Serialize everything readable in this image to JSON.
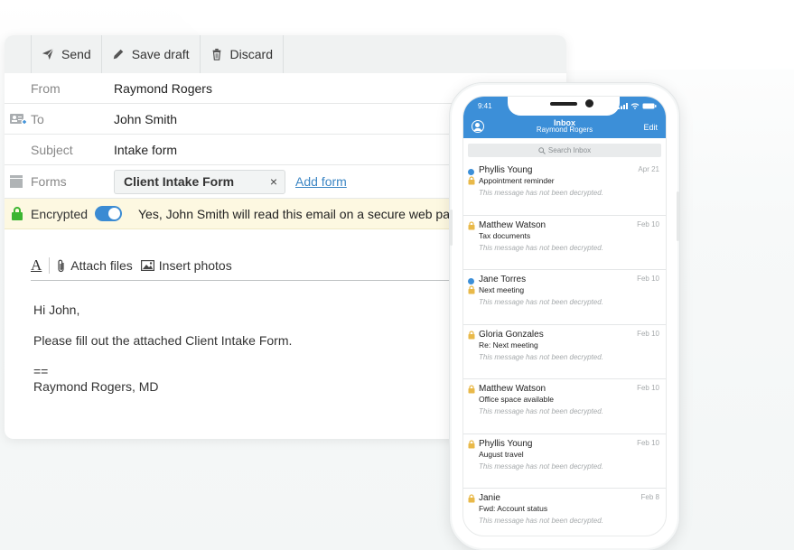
{
  "toolbar": {
    "send": "Send",
    "save_draft": "Save draft",
    "discard": "Discard"
  },
  "fields": {
    "from_label": "From",
    "from_value": "Raymond Rogers",
    "to_label": "To",
    "to_value": "John Smith",
    "subject_label": "Subject",
    "subject_value": "Intake form",
    "forms_label": "Forms",
    "form_chip": "Client Intake Form",
    "form_chip_remove": "×",
    "add_form": "Add form"
  },
  "encryption": {
    "label": "Encrypted",
    "enabled": true,
    "message": "Yes, John Smith will read this email on a secure web pa"
  },
  "format_bar": {
    "text_format": "A",
    "attach_files": "Attach files",
    "insert_photos": "Insert photos"
  },
  "body": {
    "greeting": "Hi John,",
    "line1": "Please fill out the attached Client Intake Form.",
    "separator": "==",
    "signature": "Raymond Rogers, MD"
  },
  "phone": {
    "time": "9:41",
    "title": "Inbox",
    "subtitle": "Raymond Rogers",
    "edit": "Edit",
    "search_placeholder": "Search Inbox",
    "messages": [
      {
        "sender": "Phyllis Young",
        "subject": "Appointment reminder",
        "preview": "This message has not been decrypted.",
        "date": "Apr 21",
        "unread": true
      },
      {
        "sender": "Matthew Watson",
        "subject": "Tax documents",
        "preview": "This message has not been decrypted.",
        "date": "Feb 10",
        "unread": false
      },
      {
        "sender": "Jane Torres",
        "subject": "Next meeting",
        "preview": "This message has not been decrypted.",
        "date": "Feb 10",
        "unread": true
      },
      {
        "sender": "Gloria Gonzales",
        "subject": "Re: Next meeting",
        "preview": "This message has not been decrypted.",
        "date": "Feb 10",
        "unread": false
      },
      {
        "sender": "Matthew Watson",
        "subject": "Office space available",
        "preview": "This message has not been decrypted.",
        "date": "Feb 10",
        "unread": false
      },
      {
        "sender": "Phyllis Young",
        "subject": "August travel",
        "preview": "This message has not been decrypted.",
        "date": "Feb 10",
        "unread": false
      },
      {
        "sender": "Janie",
        "subject": "Fwd: Account status",
        "preview": "This message has not been decrypted.",
        "date": "Feb 8",
        "unread": false
      }
    ]
  },
  "colors": {
    "accent_blue": "#3c8fd8",
    "encrypted_bg": "#fdf8e1",
    "lock_green": "#3cb531",
    "lock_gold": "#e9b949",
    "link": "#3c86c4"
  }
}
